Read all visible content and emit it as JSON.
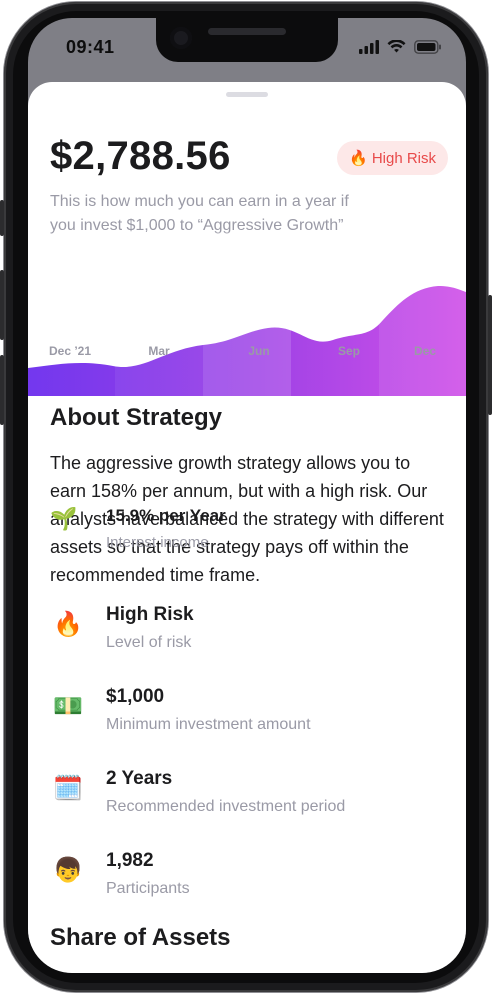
{
  "status_bar": {
    "time": "09:41"
  },
  "header": {
    "amount": "$2,788.56",
    "risk_badge": {
      "icon": "fire-icon",
      "label": "High Risk"
    },
    "description": "This is how much you can earn in a year if you invest $1,000 to “Aggressive Growth”"
  },
  "chart": {
    "x_labels": [
      "Dec ’21",
      "Mar",
      "Jun",
      "Sep",
      "Dec"
    ],
    "colors": [
      "#7a3df0",
      "#a64cf0",
      "#c550e8"
    ]
  },
  "about": {
    "title": "About Strategy",
    "paragraph": "The aggressive growth strategy allows you to earn 158% per annum, but with a high risk. Our analysts have balanced the strategy with different assets so that the strategy pays off within the recommended time frame.",
    "overlay": {
      "icon": "sprout-icon",
      "title": "15.9% per Year",
      "subtitle": "Interest income"
    }
  },
  "stats": [
    {
      "icon": "fire-icon",
      "title": "High Risk",
      "subtitle": "Level of risk"
    },
    {
      "icon": "money-bill-icon",
      "title": "$1,000",
      "subtitle": "Minimum investment amount"
    },
    {
      "icon": "calendar-icon",
      "title": "2 Years",
      "subtitle": "Recommended investment period"
    },
    {
      "icon": "person-icon",
      "title": "1,982",
      "subtitle": "Participants"
    }
  ],
  "assets": {
    "title": "Share of Assets"
  }
}
